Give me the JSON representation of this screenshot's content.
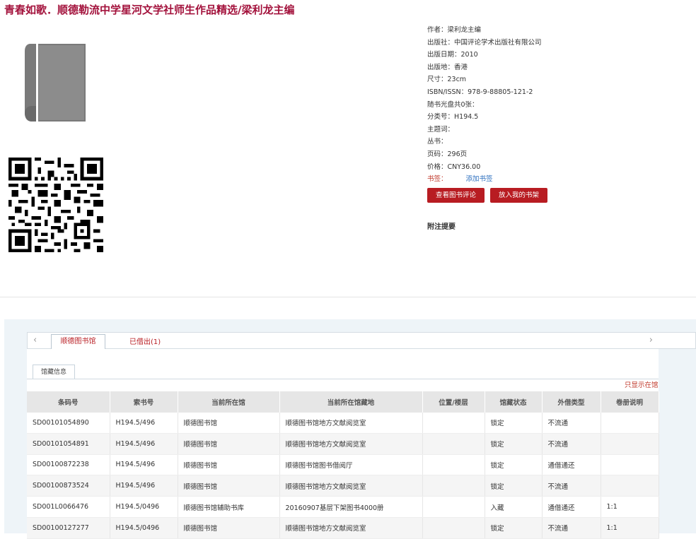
{
  "title": "青春如歌．顺德勒流中学星河文学社师生作品精选/梁利龙主编",
  "icons": {
    "book": "book-icon",
    "qr": "qr-code-icon"
  },
  "meta": [
    "作者：梁利龙主编",
    "出版社：中国评论学术出版社有限公司",
    "出版日期：2010",
    "出版地：香港",
    "尺寸：23cm",
    "ISBN/ISSN：978-9-88805-121-2",
    "随书光盘共0张：",
    "分类号：H194.5",
    "主题词：",
    "丛书：",
    "页码：296页",
    "价格：CNY36.00"
  ],
  "bookmark": {
    "label": "书签：",
    "link": "添加书签"
  },
  "buttons": {
    "view_reviews": "查看图书评论",
    "add_shelf": "放入我的书架"
  },
  "notes_heading": "附注提要",
  "tabs": {
    "active": "顺德图书馆",
    "second": "已借出(1)"
  },
  "subtab": "馆藏信息",
  "only_show": "只显示在馆",
  "table": {
    "headers": [
      "条码号",
      "索书号",
      "当前所在馆",
      "当前所在馆藏地",
      "位置/楼层",
      "馆藏状态",
      "外借类型",
      "卷册说明"
    ],
    "rows": [
      [
        "SD00101054890",
        "H194.5/496",
        "顺德图书馆",
        "顺德图书馆地方文献阅览室",
        "",
        "锁定",
        "不流通",
        ""
      ],
      [
        "SD00101054891",
        "H194.5/496",
        "顺德图书馆",
        "顺德图书馆地方文献阅览室",
        "",
        "锁定",
        "不流通",
        ""
      ],
      [
        "SD00100872238",
        "H194.5/496",
        "顺德图书馆",
        "顺德图书馆图书借阅厅",
        "",
        "锁定",
        "通借通还",
        ""
      ],
      [
        "SD00100873524",
        "H194.5/496",
        "顺德图书馆",
        "顺德图书馆地方文献阅览室",
        "",
        "锁定",
        "不流通",
        ""
      ],
      [
        "SD001L0066476",
        "H194.5/0496",
        "顺德图书馆辅助书库",
        "20160907基层下架图书4000册",
        "",
        "入藏",
        "通借通还",
        "1:1"
      ],
      [
        "SD00100127277",
        "H194.5/0496",
        "顺德图书馆",
        "顺德图书馆地方文献阅览室",
        "",
        "锁定",
        "不流通",
        "1:1"
      ]
    ]
  }
}
